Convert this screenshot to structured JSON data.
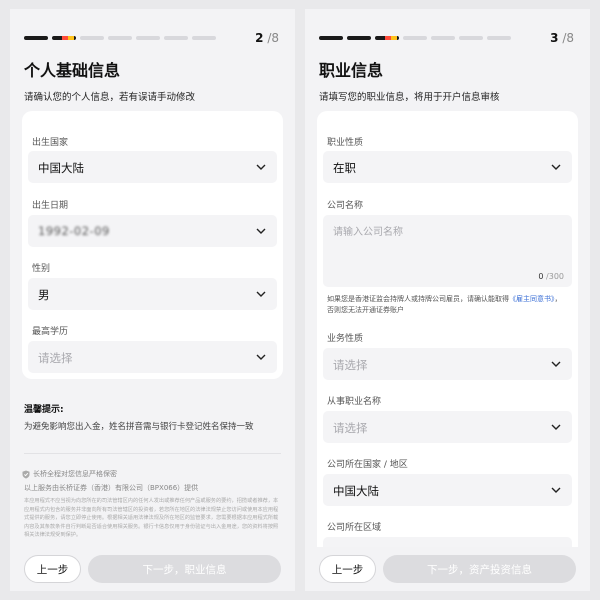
{
  "screen1": {
    "step_current": "2",
    "step_total": "/8",
    "title": "个人基础信息",
    "subtitle": "请确认您的个人信息，若有误请手动修改",
    "fields": [
      {
        "label": "出生国家",
        "value": "中国大陆"
      },
      {
        "label": "出生日期",
        "value": "1992-02-09"
      },
      {
        "label": "性别",
        "value": "男"
      },
      {
        "label": "最高学历",
        "placeholder": "请选择"
      }
    ],
    "tips_title": "温馨提示:",
    "tips_text": "为避免影响您出入金，姓名拼音需与银行卡登记姓名保持一致",
    "secure_text": "长桥全程对您信息严格保密",
    "provider_text": "以上服务由长桥证券（香港）有限公司（BPX066）提供",
    "disclaimer": "本应用程式不应当视为向您所在的司法管辖区内的任何人发出或推荐任何产品或服务的要约，招揽或者推荐，本应用程式内包含的服务并非面向所有司法管辖区的投资者，若您所在地区的法律法规禁止您访问或使用本应用程式提供的服务，请您立即停止使用。根据相关适用法律法规及所在地区的监管要求，您需要根据本应用程式所载内容及其条款条件自行判断是否适合使用相关服务。银行卡信息仅用于身份验证与出入金用途，您的资料将按照相关法律法规受到保护。",
    "prev_label": "上一步",
    "next_label": "下一步，职业信息"
  },
  "screen2": {
    "step_current": "3",
    "step_total": "/8",
    "title": "职业信息",
    "subtitle": "请填写您的职业信息，将用于开户信息审核",
    "occupation_label": "职业性质",
    "occupation_value": "在职",
    "company_label": "公司名称",
    "company_placeholder": "请输入公司名称",
    "company_count": "0",
    "company_max": "/300",
    "note_text": "如果您是香港证监会持牌人或持牌公司雇员，请确认能取得",
    "note_link": "《雇主同意书》",
    "note_tail": "，否则您无法开通证券账户",
    "business_label": "业务性质",
    "business_placeholder": "请选择",
    "job_label": "从事职业名称",
    "job_placeholder": "请选择",
    "country_label": "公司所在国家 / 地区",
    "country_value": "中国大陆",
    "region_label": "公司所在区域",
    "prev_label": "上一步",
    "next_label": "下一步，资产投资信息"
  }
}
